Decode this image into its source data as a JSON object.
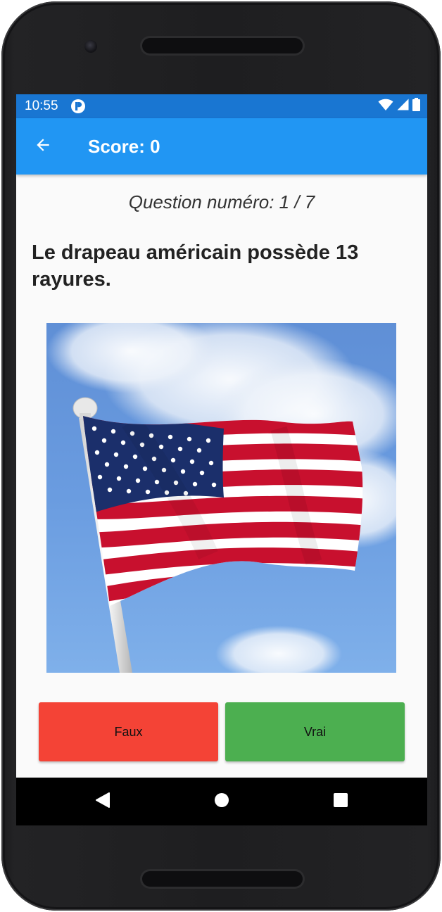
{
  "status_bar": {
    "time": "10:55",
    "icons": [
      "app-notification-icon",
      "wifi-icon",
      "cell-signal-icon",
      "battery-icon"
    ]
  },
  "app_bar": {
    "back_icon": "arrow-back-icon",
    "title": "Score: 0"
  },
  "quiz": {
    "question_number": "Question numéro: 1 / 7",
    "question_text": "Le drapeau américain possède 13 rayures.",
    "image": "american-flag-photo",
    "buttons": {
      "false_label": "Faux",
      "true_label": "Vrai"
    }
  },
  "nav_bar": {
    "icons": [
      "back-triangle-icon",
      "home-circle-icon",
      "recents-square-icon"
    ]
  },
  "colors": {
    "status_bar": "#1976d2",
    "app_bar": "#2196f3",
    "false_button": "#f44336",
    "true_button": "#4caf50",
    "background": "#fafafa"
  }
}
